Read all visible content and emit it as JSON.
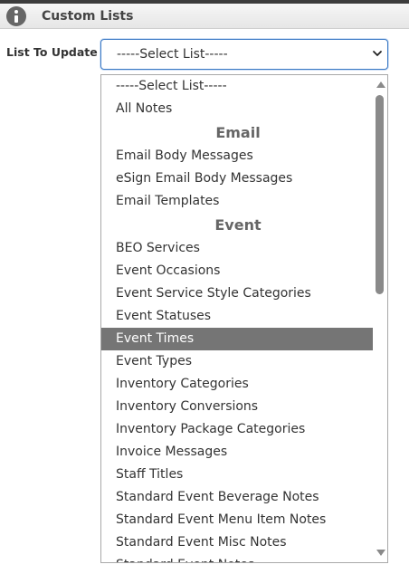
{
  "header": {
    "title": "Custom Lists",
    "icon": "info-icon"
  },
  "form": {
    "label": "List To Update",
    "select_value": "-----Select List-----"
  },
  "dropdown": {
    "selected_label": "Event Times",
    "highlight_color": "#757575",
    "options": [
      {
        "label": "-----Select List-----",
        "type": "option"
      },
      {
        "label": "All Notes",
        "type": "option"
      },
      {
        "label": "Email",
        "type": "group"
      },
      {
        "label": "Email Body Messages",
        "type": "option"
      },
      {
        "label": "eSign Email Body Messages",
        "type": "option"
      },
      {
        "label": "Email Templates",
        "type": "option"
      },
      {
        "label": "Event",
        "type": "group"
      },
      {
        "label": "BEO Services",
        "type": "option"
      },
      {
        "label": "Event Occasions",
        "type": "option"
      },
      {
        "label": "Event Service Style Categories",
        "type": "option"
      },
      {
        "label": "Event Statuses",
        "type": "option"
      },
      {
        "label": "Event Times",
        "type": "option"
      },
      {
        "label": "Event Types",
        "type": "option"
      },
      {
        "label": "Inventory Categories",
        "type": "option"
      },
      {
        "label": "Inventory Conversions",
        "type": "option"
      },
      {
        "label": "Inventory Package Categories",
        "type": "option"
      },
      {
        "label": "Invoice Messages",
        "type": "option"
      },
      {
        "label": "Staff Titles",
        "type": "option"
      },
      {
        "label": "Standard Event Beverage Notes",
        "type": "option"
      },
      {
        "label": "Standard Event Menu Item Notes",
        "type": "option"
      },
      {
        "label": "Standard Event Misc Notes",
        "type": "option"
      },
      {
        "label": "Standard Event Notes",
        "type": "option"
      }
    ]
  }
}
